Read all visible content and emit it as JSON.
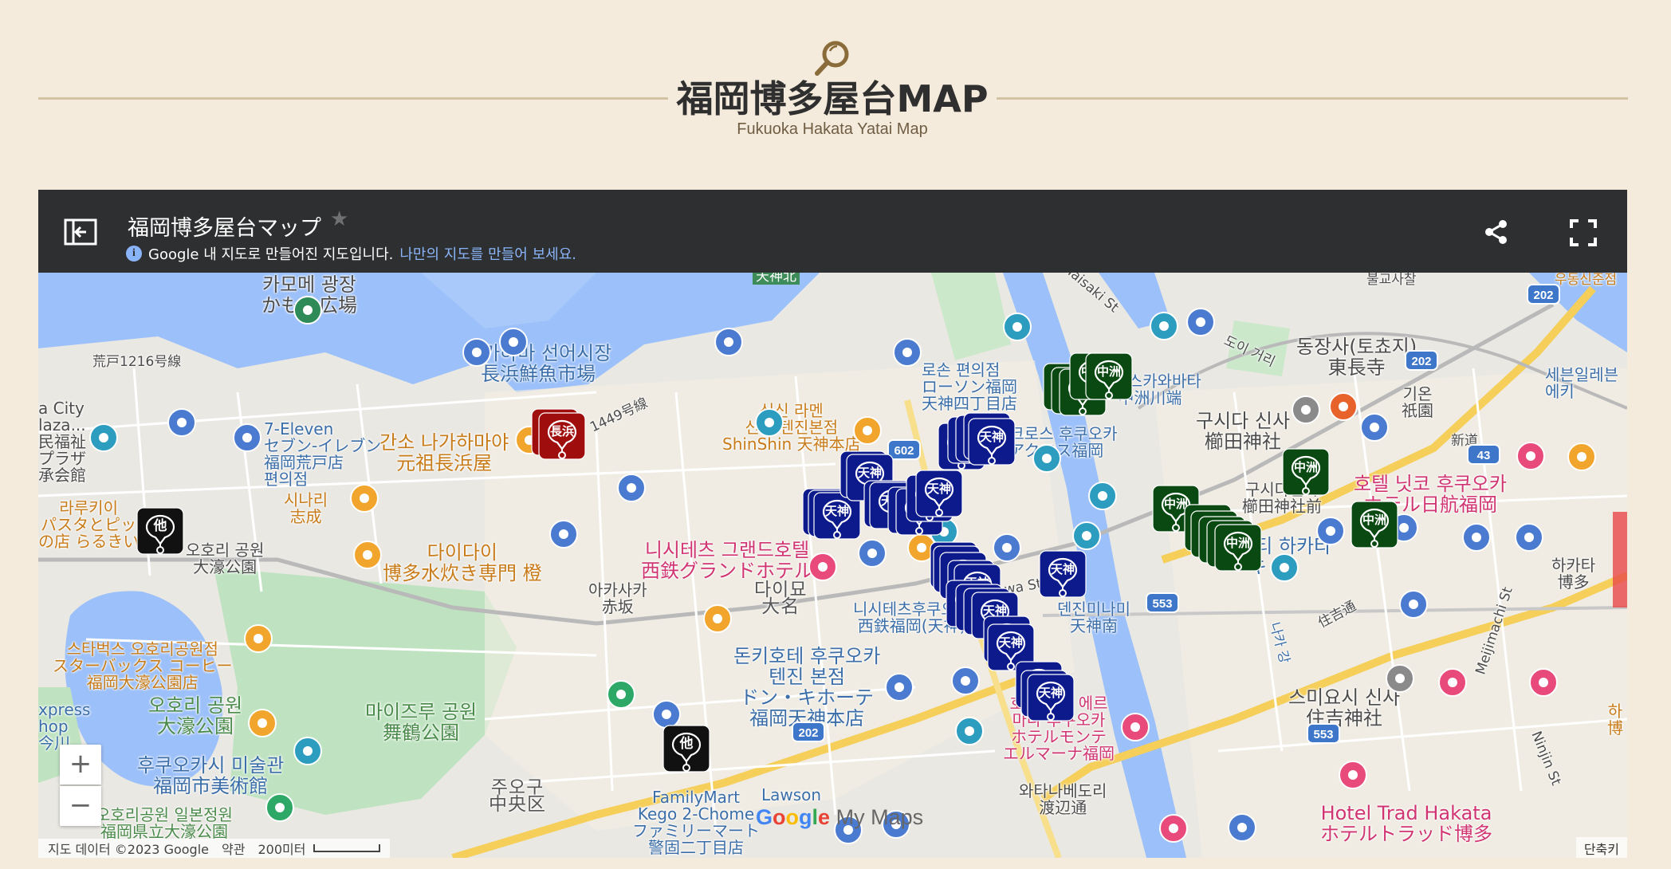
{
  "header": {
    "title": "福岡博多屋台MAP",
    "subtitle": "Fukuoka Hakata Yatai Map"
  },
  "map": {
    "title": "福岡博多屋台マップ",
    "info_text": "Google 내 지도로 만들어진 지도입니다.",
    "info_link": "나만의 지도를 만들어 보세요.",
    "zoom_in": "+",
    "zoom_out": "−",
    "attribution": "지도 데이터 ©2023 Google",
    "terms": "약관",
    "scale": "200미터",
    "shortcuts": "단축키",
    "logo": "Google My Maps",
    "labels": [
      {
        "text": "카모메 광장\nかもめ広場",
        "cls": "dark"
      },
      {
        "text": "荒戸1216号線",
        "cls": "dark small"
      },
      {
        "text": "a City\nlaza...\n民福祉\nプラザ\n承会館",
        "cls": "dark"
      },
      {
        "text": "7-Eleven\nセブン-イレブン\n福岡荒戸店\n편의점",
        "cls": "blue"
      },
      {
        "text": "간소 나가하마야\n元祖長浜屋",
        "cls": "orange big"
      },
      {
        "text": "1449号線",
        "cls": "dark small"
      },
      {
        "text": "나가하마 선어시장\n長浜鮮魚市場",
        "cls": "blue big"
      },
      {
        "text": "라루키이\nパスタとピッ\nの店 らるきい",
        "cls": "orange"
      },
      {
        "text": "시나리\n志成",
        "cls": "orange"
      },
      {
        "text": "오호리 공원\n大濠公園",
        "cls": "dark"
      },
      {
        "text": "다이다이\n博多水炊き専門 橙",
        "cls": "orange big"
      },
      {
        "text": "신신 라멘\n신신 텐진본점\nShinShin 天神本店",
        "cls": "orange"
      },
      {
        "text": "니시테츠 그랜드호텔\n西鉄グランドホテル",
        "cls": "pink big"
      },
      {
        "text": "아카사카\n赤坂",
        "cls": "dark"
      },
      {
        "text": "다이묘\n大名",
        "cls": "area"
      },
      {
        "text": "니시테츠후쿠오카\n西鉄福岡(天神)",
        "cls": "blue"
      },
      {
        "text": "로손 편의점\nローソン福岡\n天神四丁目店",
        "cls": "blue"
      },
      {
        "text": "아크로스 후쿠오카\nアクロス福岡",
        "cls": "blue"
      },
      {
        "text": "나카스카와바타\n中洲川端",
        "cls": "blue"
      },
      {
        "text": "구시다 신사\n櫛田神社",
        "cls": "dark big"
      },
      {
        "text": "동장사(토쵸지)\n東長寺",
        "cls": "dark big"
      },
      {
        "text": "도이 거리",
        "cls": "dark small"
      },
      {
        "text": "불교사찰",
        "cls": "dark small"
      },
      {
        "text": "기온\n祇園",
        "cls": "dark"
      },
      {
        "text": "新道",
        "cls": "dark small"
      },
      {
        "text": "세븐일레븐\n에키",
        "cls": "blue"
      },
      {
        "text": "우동신준점",
        "cls": "orange small"
      },
      {
        "text": "구시다진자\n櫛田神社前",
        "cls": "dark"
      },
      {
        "text": "호텔 닛코 후쿠오카\nホテル日航福岡",
        "cls": "pink big"
      },
      {
        "text": "캐널시티 하카타\nキャ",
        "cls": "blue big"
      },
      {
        "text": "하카타\n博多",
        "cls": "dark"
      },
      {
        "text": "스타벅스 오호리공원점\nスターバックス コーヒー\n福岡大濠公園店",
        "cls": "orange"
      },
      {
        "text": "오호리 공원\n大濠公園",
        "cls": "green big"
      },
      {
        "text": "마이즈루 공원\n舞鶴公園",
        "cls": "green big"
      },
      {
        "text": "xpress\nhop\n今川",
        "cls": "blue"
      },
      {
        "text": "후쿠오카시 미술관\n福岡市美術館",
        "cls": "blue big"
      },
      {
        "text": "오호리공원 일본정원\n福岡県立大濠公園",
        "cls": "green"
      },
      {
        "text": "돈키호테 후쿠오카\n텐진 본점\nドン・キホーテ\n福岡天神本店",
        "cls": "blue big"
      },
      {
        "text": "덴진미나미\n天神南",
        "cls": "blue"
      },
      {
        "text": "주오구\n中央区",
        "cls": "area"
      },
      {
        "text": "FamilyMart\nKego 2-Chome\nファミリーマート\n警固二丁目店",
        "cls": "blue"
      },
      {
        "text": "Lawson",
        "cls": "blue"
      },
      {
        "text": "호텔 몬테 에르\n마나 후쿠오카\nホテルモンテ\nエルマーナ福岡",
        "cls": "pink"
      },
      {
        "text": "와타나베도리\n渡辺通",
        "cls": "dark"
      },
      {
        "text": "스미요시 신사\n住吉神社",
        "cls": "dark big"
      },
      {
        "text": "住吉通",
        "cls": "dark small"
      },
      {
        "text": "나카 강",
        "cls": "blue small"
      },
      {
        "text": "Hotel Trad Hakata\nホテルトラッド博多",
        "cls": "pink big"
      },
      {
        "text": "하\n博",
        "cls": "orange"
      },
      {
        "text": "Meijimachi St",
        "cls": "dark small"
      },
      {
        "text": "Ninjin St",
        "cls": "dark small"
      },
      {
        "text": "天神北",
        "cls": "dark small"
      },
      {
        "text": "Showa St",
        "cls": "dark small"
      },
      {
        "text": "Taisaki St",
        "cls": "dark small"
      }
    ],
    "markers": [
      {
        "label": "長浜",
        "color": "#a00d0d"
      },
      {
        "label": "他",
        "color": "#111111"
      },
      {
        "label": "他",
        "color": "#111111"
      },
      {
        "label": "天神",
        "color": "#0c1a8c"
      },
      {
        "label": "中洲",
        "color": "#0a4a12"
      }
    ],
    "road_numbers": [
      "602",
      "202",
      "202",
      "43",
      "553",
      "553",
      "202"
    ]
  }
}
